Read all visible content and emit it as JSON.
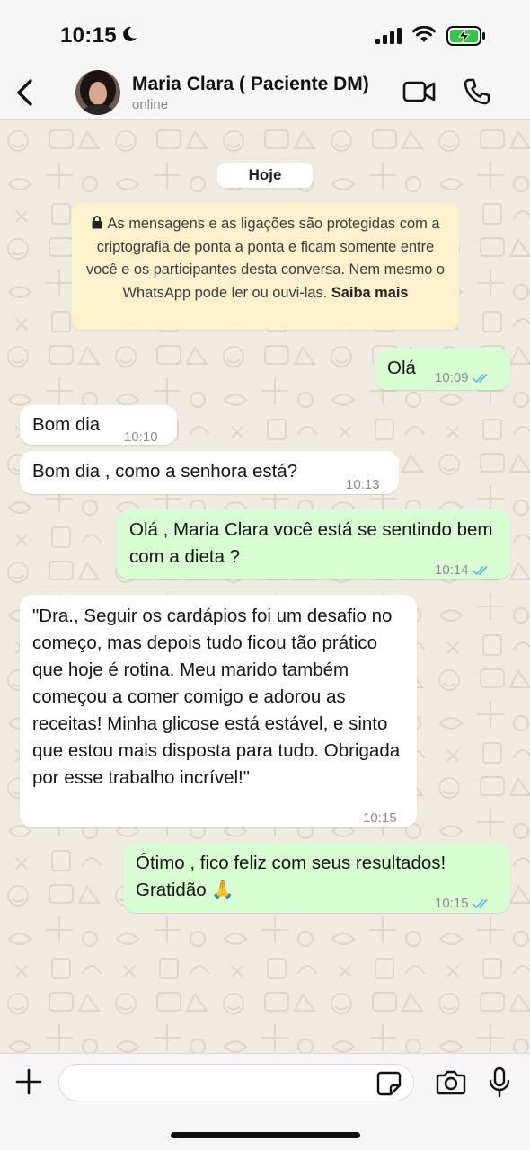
{
  "status_bar": {
    "time": "10:15",
    "icons": [
      "moon-icon",
      "cellular-signal-icon",
      "wifi-icon",
      "battery-charging-icon"
    ],
    "battery_color": "#33c748"
  },
  "header": {
    "back_icon": "chevron-left-icon",
    "contact_name": "Maria Clara ( Paciente DM)",
    "status": "online",
    "actions": [
      "video-call-icon",
      "phone-icon"
    ]
  },
  "chat": {
    "date_label": "Hoje",
    "encryption_notice": {
      "text": "As mensagens e as ligações são protegidas com a criptografia de ponta a ponta e ficam somente entre você e os participantes desta conversa. Nem mesmo o WhatsApp pode ler ou ouvi-las.",
      "link": "Saiba mais",
      "icon": "lock-icon"
    },
    "messages": [
      {
        "direction": "out",
        "text": "Olá",
        "time": "10:09",
        "read": true
      },
      {
        "direction": "in",
        "text": "Bom dia",
        "time": "10:10"
      },
      {
        "direction": "in",
        "text": "Bom dia , como a senhora está?",
        "time": "10:13"
      },
      {
        "direction": "out",
        "text": "Olá , Maria Clara você está se sentindo bem com a dieta ?",
        "time": "10:14",
        "read": true
      },
      {
        "direction": "in",
        "text": "\"Dra., Seguir os cardápios foi um desafio no começo, mas depois tudo ficou tão prático que hoje é rotina. Meu marido também começou a comer comigo e adorou as receitas! Minha glicose está estável, e sinto que estou mais disposta para tudo. Obrigada por esse trabalho incrível!\"",
        "time": "10:15"
      },
      {
        "direction": "out",
        "text": "Ótimo , fico feliz com seus resultados! Gratidão 🙏",
        "time": "10:15",
        "read": true
      }
    ]
  },
  "composer": {
    "placeholder": "",
    "icons": [
      "plus-icon",
      "sticker-icon",
      "camera-icon",
      "microphone-icon"
    ]
  },
  "colors": {
    "incoming_bubble": "#ffffff",
    "outgoing_bubble": "#d9fdd3",
    "chat_background": "#efeae2",
    "encryption_notice": "#fdf1cc",
    "read_ticks": "#53bdeb"
  }
}
